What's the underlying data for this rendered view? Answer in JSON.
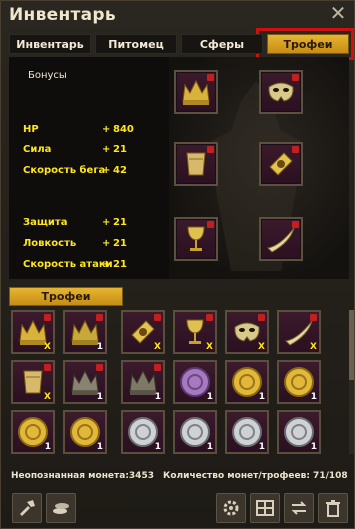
{
  "window": {
    "title": "Инвентарь",
    "close_label": "✕"
  },
  "tabs": [
    {
      "label": "Инвентарь"
    },
    {
      "label": "Питомец"
    },
    {
      "label": "Сферы"
    },
    {
      "label": "Трофеи",
      "active": true
    }
  ],
  "stats": {
    "heading": "Бонусы",
    "rows": [
      {
        "name": "HP",
        "plus": "+",
        "value": "840"
      },
      {
        "name": "Сила",
        "plus": "+",
        "value": "21"
      },
      {
        "name": "Скорость бега",
        "plus": "+",
        "value": "42"
      },
      {
        "name": "Защита",
        "plus": "+",
        "value": "21"
      },
      {
        "name": "Ловкость",
        "plus": "+",
        "value": "21"
      },
      {
        "name": "Скорость атаки",
        "plus": "+",
        "value": "21"
      }
    ]
  },
  "equipped": [
    {
      "item": "crown-icon"
    },
    {
      "item": "mask-icon"
    },
    {
      "item": "bracer-icon"
    },
    {
      "item": "bracer-gold-icon"
    },
    {
      "item": "goblet-icon"
    },
    {
      "item": "horn-icon"
    }
  ],
  "trophies_label": "Трофеи",
  "trophy_grid": [
    {
      "item": "crown-icon",
      "count": "X"
    },
    {
      "item": "crown-icon",
      "count": "1"
    },
    {
      "item": "bracer-gold-icon",
      "count": "X"
    },
    {
      "item": "goblet-icon",
      "count": "X"
    },
    {
      "item": "mask-icon",
      "count": "X"
    },
    {
      "item": "horn-icon",
      "count": "X"
    },
    {
      "item": "bracer-icon",
      "count": "X"
    },
    {
      "item": "crown-dark-icon",
      "count": "1"
    },
    {
      "item": "crown-dark-icon",
      "count": "1"
    },
    {
      "item": "coin-purple-icon",
      "count": "1"
    },
    {
      "item": "coin-gold-icon",
      "count": "1"
    },
    {
      "item": "coin-gold-icon",
      "count": "1"
    },
    {
      "item": "coin-gold-icon",
      "count": "1"
    },
    {
      "item": "coin-gold-icon",
      "count": "1"
    },
    {
      "item": "coin-silver-icon",
      "count": "1"
    },
    {
      "item": "coin-silver-icon",
      "count": "1"
    },
    {
      "item": "coin-silver-icon",
      "count": "1"
    },
    {
      "item": "coin-silver-icon",
      "count": "1"
    }
  ],
  "footer": {
    "unknown_coin": "Неопознанная монета:3453",
    "coin_count": "Количество монет/трофеев: 71/108"
  },
  "colors": {
    "accent": "#d9a21f",
    "stat": "#ffe61a",
    "highlight": "#d00f0f"
  }
}
